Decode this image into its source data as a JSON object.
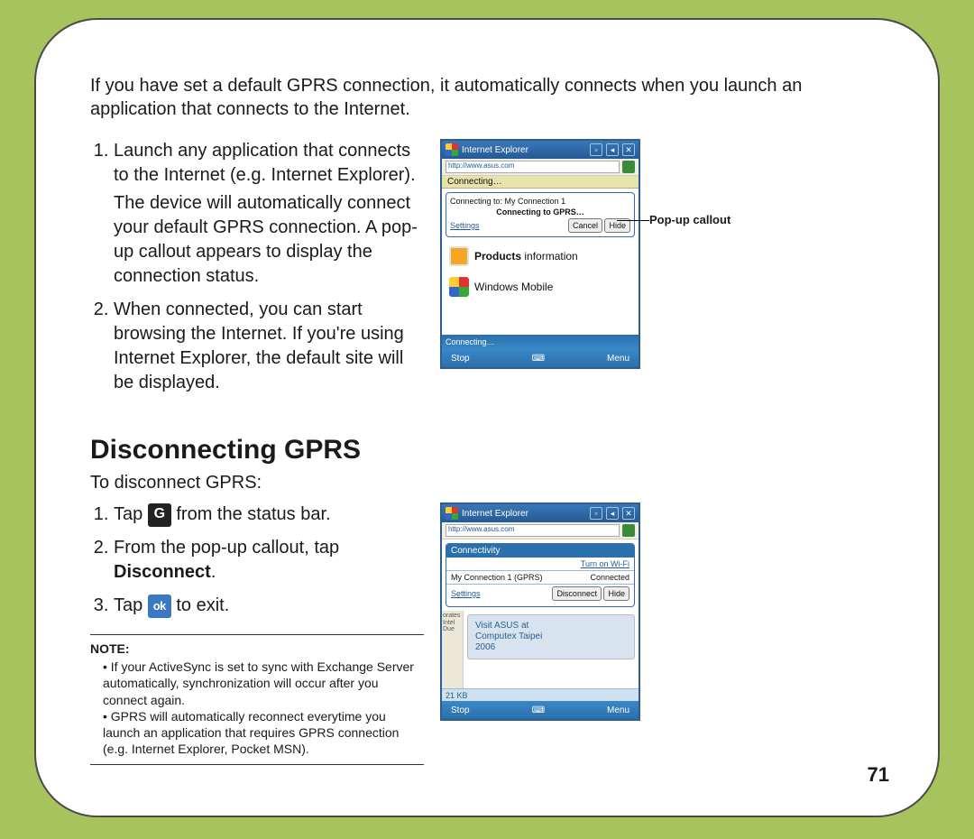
{
  "page_number": "71",
  "intro": "If you have set a default GPRS connection, it automatically connects when you launch an application that connects to the Internet.",
  "connect_steps": {
    "s1": "Launch any application that connects to the Internet (e.g. Internet Explorer).",
    "s1_sub": "The device will automatically connect your default GPRS connection. A pop-up callout appears to display the connection status.",
    "s2": "When connected, you can start browsing the Internet. If you're using Internet Explorer, the default site will be displayed."
  },
  "sections": {
    "disconnect_heading": "Disconnecting GPRS",
    "disconnect_sub": "To disconnect GPRS:"
  },
  "disconnect_steps": {
    "s1_a": "Tap ",
    "s1_icon": "G",
    "s1_b": " from the status bar.",
    "s2_a": "From the pop-up callout, tap ",
    "s2_bold": "Disconnect",
    "s2_b": ".",
    "s3_a": "Tap ",
    "s3_icon": "ok",
    "s3_b": " to exit."
  },
  "note": {
    "label": "NOTE:",
    "n1": "If your ActiveSync is set to sync with Exchange Server automatically, synchronization will occur after you connect again.",
    "n2": "GPRS will automatically reconnect everytime you launch an application that requires GPRS connection (e.g. Internet Explorer, Pocket MSN)."
  },
  "annotation": {
    "popup_label": "Pop-up callout"
  },
  "screenshot1": {
    "title": "Internet Explorer",
    "url": "http://www.asus.com",
    "banner": "Connecting…",
    "callout_line1": "Connecting to: My Connection 1",
    "callout_line2": "Connecting to GPRS…",
    "settings": "Settings",
    "cancel": "Cancel",
    "hide": "Hide",
    "item1_b": "Products",
    "item1_r": " information",
    "item2": "Windows Mobile",
    "status": "Connecting…",
    "soft_left": "Stop",
    "soft_right": "Menu"
  },
  "screenshot2": {
    "title": "Internet Explorer",
    "url": "http://www.asus.com",
    "conn_header": "Connectivity",
    "turn_on": "Turn on Wi-Fi",
    "conn_name": "My Connection 1 (GPRS)",
    "conn_state": "Connected",
    "settings": "Settings",
    "disconnect": "Disconnect",
    "hide": "Hide",
    "side1": "orates",
    "side2": "Intel",
    "side3": "Due",
    "promo1": "Visit ASUS at",
    "promo2": "Computex Taipei",
    "promo3": "2006",
    "size": "21 KB",
    "soft_left": "Stop",
    "soft_right": "Menu"
  }
}
